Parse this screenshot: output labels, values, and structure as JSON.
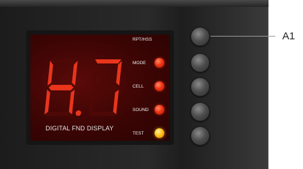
{
  "display": {
    "label": "DIGITAL FND DISPLAY",
    "digits": [
      "H",
      "7"
    ],
    "decimal_point_lit": true,
    "segment_color": "#e8351c",
    "segment_off_color": "#4e0806"
  },
  "indicators": [
    {
      "label": "RPT/HSS",
      "led": "none"
    },
    {
      "label": "MODE",
      "led": "red"
    },
    {
      "label": "CELL",
      "led": "red"
    },
    {
      "label": "SOUND",
      "led": "red"
    },
    {
      "label": "TEST",
      "led": "amber"
    }
  ],
  "buttons": [
    "button-1",
    "button-2",
    "button-3",
    "button-4",
    "button-5"
  ],
  "callout": {
    "label": "A1"
  }
}
